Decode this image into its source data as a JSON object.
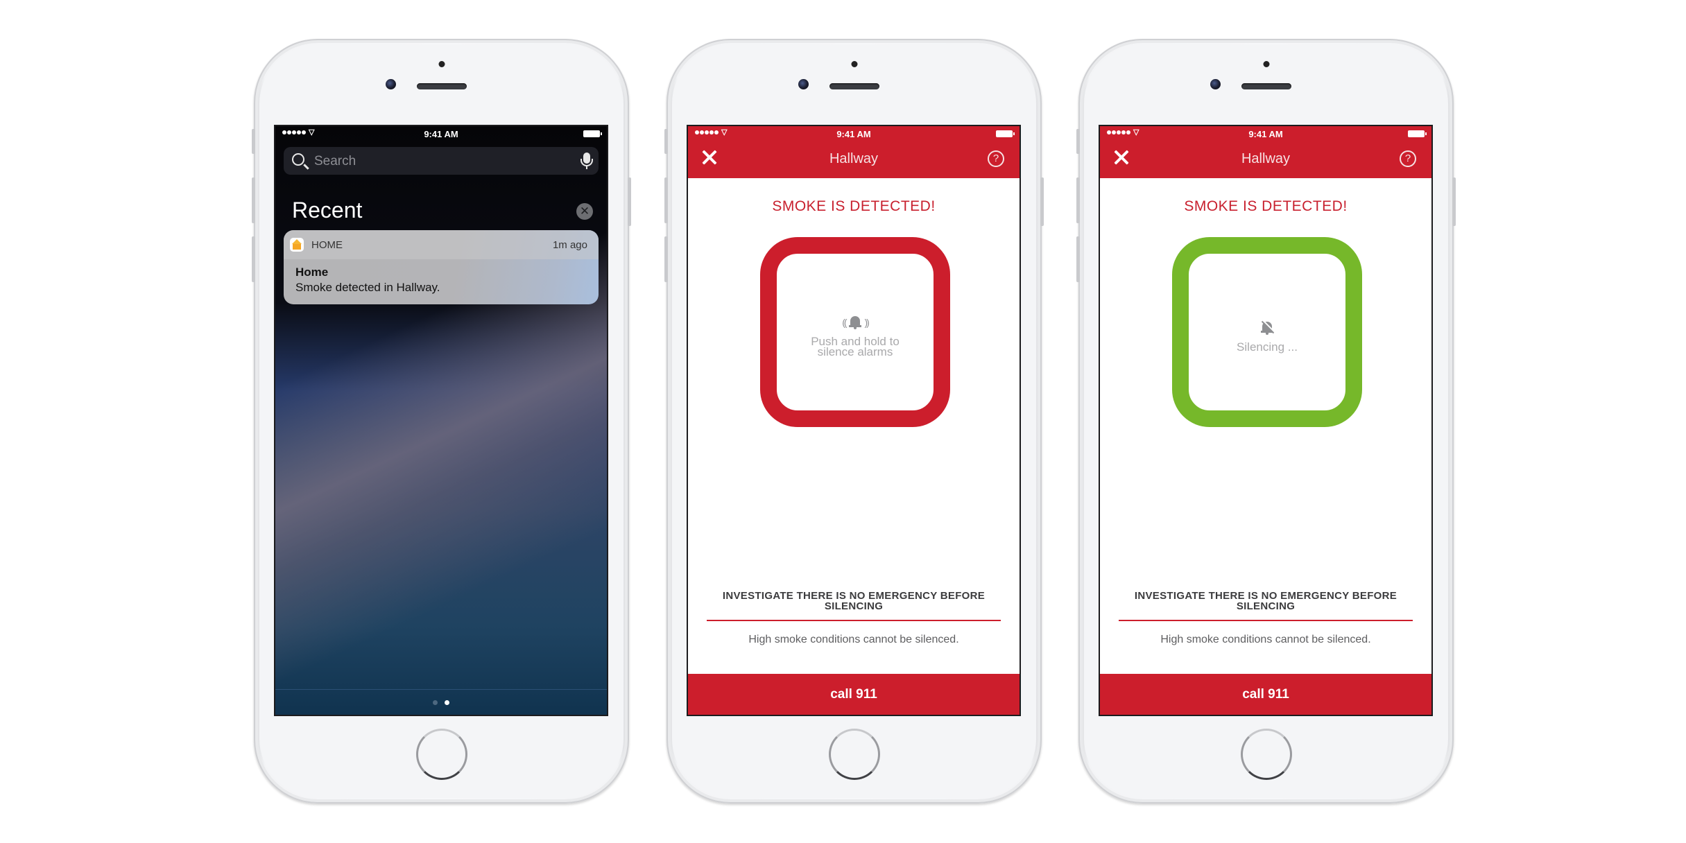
{
  "status_bar": {
    "time": "9:41 AM"
  },
  "phones": [
    {
      "screen": "notification-center",
      "search": {
        "placeholder": "Search"
      },
      "section_title": "Recent",
      "notification": {
        "app_name": "HOME",
        "age": "1m ago",
        "title": "Home",
        "body": "Smoke detected in Hallway."
      },
      "page_dots": {
        "count": 2,
        "active_index": 1
      }
    },
    {
      "screen": "alarm",
      "title": "Hallway",
      "alert": "SMOKE IS DETECTED!",
      "button_state": "alarm",
      "button_color": "#cc1e2c",
      "button_text_line1": "Push and hold to",
      "button_text_line2": "silence alarms",
      "icon": "bell-ringing-icon",
      "warning": "INVESTIGATE THERE IS NO EMERGENCY BEFORE SILENCING",
      "note": "High smoke conditions cannot be silenced.",
      "call_label": "call 911"
    },
    {
      "screen": "silencing",
      "title": "Hallway",
      "alert": "SMOKE IS DETECTED!",
      "button_state": "silencing",
      "button_color": "#76b82a",
      "button_text": "Silencing ...",
      "icon": "bell-off-icon",
      "warning": "INVESTIGATE THERE IS NO EMERGENCY BEFORE SILENCING",
      "note": "High smoke conditions cannot be silenced.",
      "call_label": "call 911"
    }
  ],
  "colors": {
    "brand_red": "#cc1e2c",
    "silence_green": "#76b82a"
  }
}
